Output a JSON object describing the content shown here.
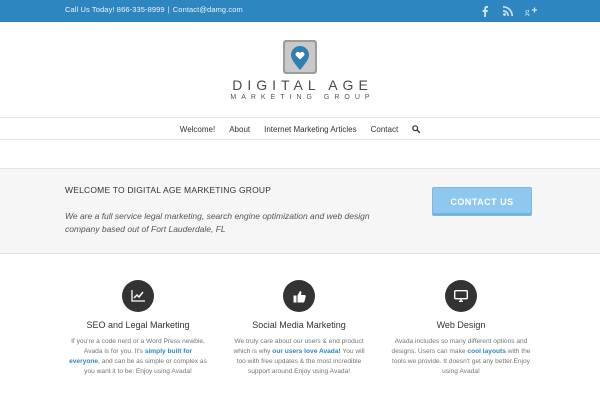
{
  "topbar": {
    "phone": "Call Us Today! 866-335-8999",
    "separator": "|",
    "email": "Contact@damg.com",
    "social_icons": [
      "facebook-icon",
      "rss-icon",
      "google-plus-icon"
    ]
  },
  "header": {
    "brand": "DIGITAL AGE",
    "tagline": "MARKETING GROUP",
    "logo_icon": "heart-location-pin-icon"
  },
  "nav": {
    "items": [
      "Welcome!",
      "About",
      "Internet Marketing Articles",
      "Contact"
    ],
    "search_icon": "search-icon"
  },
  "banner": {
    "headline": "WELCOME TO DIGITAL AGE MARKETING GROUP",
    "description": "We are a full service legal marketing, search engine optimization and web design company based out of Fort Lauderdale, FL",
    "cta_label": "CONTACT US"
  },
  "features": [
    {
      "icon": "line-chart-icon",
      "title": "SEO and Legal Marketing",
      "body_parts": [
        "If you're a code nerd or a Word Press newbie, Avada is for you. It's ",
        "simply built for everyone",
        ", and can be as simple or complex as you want it to be. Enjoy using Avada!"
      ]
    },
    {
      "icon": "thumbs-up-icon",
      "title": "Social Media Marketing",
      "body_parts": [
        "We truly care about our users & end product which is why ",
        "our users love Avada!",
        " You will too with free updates & the most incredible support around.Enjoy using Avada!"
      ]
    },
    {
      "icon": "desktop-icon",
      "title": "Web Design",
      "body_parts": [
        "Avada includes so many different options and designs. Users can make ",
        "cool layouts",
        " with the tools we provide. It doesn't get any better.Enjoy using Avada!"
      ]
    }
  ],
  "colors": {
    "topbar": "#2e86c1",
    "accent": "#2e86c1",
    "cta": "#8ec8ee",
    "icon_circle": "#333333"
  }
}
